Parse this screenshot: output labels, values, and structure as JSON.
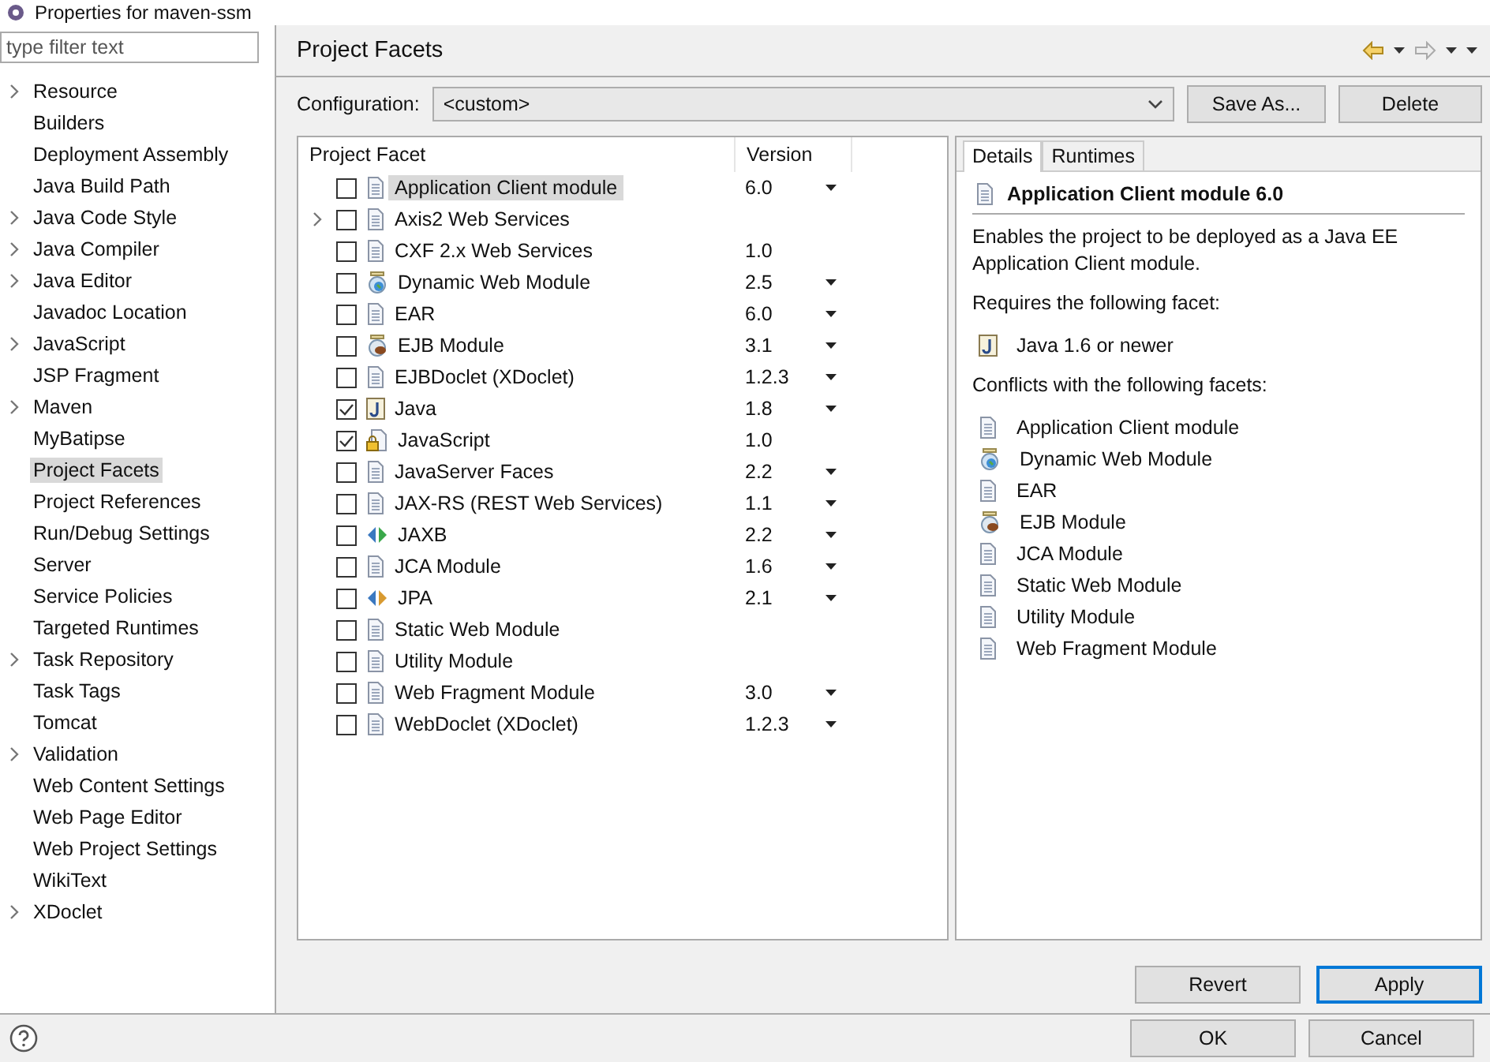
{
  "window": {
    "title": "Properties for maven-ssm"
  },
  "sidebar": {
    "filter_placeholder": "type filter text",
    "items": [
      {
        "label": "Resource",
        "has_children": true,
        "selected": false
      },
      {
        "label": "Builders",
        "has_children": false,
        "selected": false
      },
      {
        "label": "Deployment Assembly",
        "has_children": false,
        "selected": false
      },
      {
        "label": "Java Build Path",
        "has_children": false,
        "selected": false
      },
      {
        "label": "Java Code Style",
        "has_children": true,
        "selected": false
      },
      {
        "label": "Java Compiler",
        "has_children": true,
        "selected": false
      },
      {
        "label": "Java Editor",
        "has_children": true,
        "selected": false
      },
      {
        "label": "Javadoc Location",
        "has_children": false,
        "selected": false
      },
      {
        "label": "JavaScript",
        "has_children": true,
        "selected": false
      },
      {
        "label": "JSP Fragment",
        "has_children": false,
        "selected": false
      },
      {
        "label": "Maven",
        "has_children": true,
        "selected": false
      },
      {
        "label": "MyBatipse",
        "has_children": false,
        "selected": false
      },
      {
        "label": "Project Facets",
        "has_children": false,
        "selected": true
      },
      {
        "label": "Project References",
        "has_children": false,
        "selected": false
      },
      {
        "label": "Run/Debug Settings",
        "has_children": false,
        "selected": false
      },
      {
        "label": "Server",
        "has_children": false,
        "selected": false
      },
      {
        "label": "Service Policies",
        "has_children": false,
        "selected": false
      },
      {
        "label": "Targeted Runtimes",
        "has_children": false,
        "selected": false
      },
      {
        "label": "Task Repository",
        "has_children": true,
        "selected": false
      },
      {
        "label": "Task Tags",
        "has_children": false,
        "selected": false
      },
      {
        "label": "Tomcat",
        "has_children": false,
        "selected": false
      },
      {
        "label": "Validation",
        "has_children": true,
        "selected": false
      },
      {
        "label": "Web Content Settings",
        "has_children": false,
        "selected": false
      },
      {
        "label": "Web Page Editor",
        "has_children": false,
        "selected": false
      },
      {
        "label": "Web Project Settings",
        "has_children": false,
        "selected": false
      },
      {
        "label": "WikiText",
        "has_children": false,
        "selected": false
      },
      {
        "label": "XDoclet",
        "has_children": true,
        "selected": false
      }
    ]
  },
  "page": {
    "title": "Project Facets"
  },
  "configuration": {
    "label": "Configuration:",
    "value": "<custom>",
    "buttons": [
      "Save As...",
      "Delete"
    ]
  },
  "facets_table": {
    "columns": [
      "Project Facet",
      "Version"
    ],
    "rows": [
      {
        "name": "Application Client module",
        "version": "6.0",
        "kind": "doc",
        "checked": false,
        "dropdown": true,
        "has_children": false,
        "selected": true
      },
      {
        "name": "Axis2 Web Services",
        "version": "",
        "kind": "doc",
        "checked": false,
        "dropdown": false,
        "has_children": true,
        "selected": false
      },
      {
        "name": "CXF 2.x Web Services",
        "version": "1.0",
        "kind": "doc",
        "checked": false,
        "dropdown": false,
        "has_children": false,
        "selected": false
      },
      {
        "name": "Dynamic Web Module",
        "version": "2.5",
        "kind": "web",
        "checked": false,
        "dropdown": true,
        "has_children": false,
        "selected": false
      },
      {
        "name": "EAR",
        "version": "6.0",
        "kind": "doc",
        "checked": false,
        "dropdown": true,
        "has_children": false,
        "selected": false
      },
      {
        "name": "EJB Module",
        "version": "3.1",
        "kind": "bean",
        "checked": false,
        "dropdown": true,
        "has_children": false,
        "selected": false
      },
      {
        "name": "EJBDoclet (XDoclet)",
        "version": "1.2.3",
        "kind": "doc",
        "checked": false,
        "dropdown": true,
        "has_children": false,
        "selected": false
      },
      {
        "name": "Java",
        "version": "1.8",
        "kind": "java",
        "checked": true,
        "dropdown": true,
        "has_children": false,
        "selected": false
      },
      {
        "name": "JavaScript",
        "version": "1.0",
        "kind": "locked",
        "checked": true,
        "dropdown": false,
        "has_children": false,
        "selected": false
      },
      {
        "name": "JavaServer Faces",
        "version": "2.2",
        "kind": "doc",
        "checked": false,
        "dropdown": true,
        "has_children": false,
        "selected": false
      },
      {
        "name": "JAX-RS (REST Web Services)",
        "version": "1.1",
        "kind": "doc",
        "checked": false,
        "dropdown": true,
        "has_children": false,
        "selected": false
      },
      {
        "name": "JAXB",
        "version": "2.2",
        "kind": "binding",
        "checked": false,
        "dropdown": true,
        "has_children": false,
        "selected": false
      },
      {
        "name": "JCA Module",
        "version": "1.6",
        "kind": "doc",
        "checked": false,
        "dropdown": true,
        "has_children": false,
        "selected": false
      },
      {
        "name": "JPA",
        "version": "2.1",
        "kind": "persistence",
        "checked": false,
        "dropdown": true,
        "has_children": false,
        "selected": false
      },
      {
        "name": "Static Web Module",
        "version": "",
        "kind": "doc",
        "checked": false,
        "dropdown": false,
        "has_children": false,
        "selected": false
      },
      {
        "name": "Utility Module",
        "version": "",
        "kind": "doc",
        "checked": false,
        "dropdown": false,
        "has_children": false,
        "selected": false
      },
      {
        "name": "Web Fragment Module",
        "version": "3.0",
        "kind": "doc",
        "checked": false,
        "dropdown": true,
        "has_children": false,
        "selected": false
      },
      {
        "name": "WebDoclet (XDoclet)",
        "version": "1.2.3",
        "kind": "doc",
        "checked": false,
        "dropdown": true,
        "has_children": false,
        "selected": false
      }
    ]
  },
  "details": {
    "tabs": [
      {
        "label": "Details",
        "selected": true
      },
      {
        "label": "Runtimes",
        "selected": false
      }
    ],
    "title": "Application Client module 6.0",
    "description": "Enables the project to be deployed as a Java EE Application Client module.",
    "requires_label": "Requires the following facet:",
    "requires": [
      {
        "name": "Java 1.6 or newer",
        "kind": "java"
      }
    ],
    "conflicts_label": "Conflicts with the following facets:",
    "conflicts": [
      {
        "name": "Application Client module",
        "kind": "doc"
      },
      {
        "name": "Dynamic Web Module",
        "kind": "web"
      },
      {
        "name": "EAR",
        "kind": "doc"
      },
      {
        "name": "EJB Module",
        "kind": "bean"
      },
      {
        "name": "JCA Module",
        "kind": "doc"
      },
      {
        "name": "Static Web Module",
        "kind": "doc"
      },
      {
        "name": "Utility Module",
        "kind": "doc"
      },
      {
        "name": "Web Fragment Module",
        "kind": "doc"
      }
    ]
  },
  "page_buttons": [
    "Revert",
    "Apply"
  ],
  "dialog_buttons": [
    "OK",
    "Cancel"
  ]
}
